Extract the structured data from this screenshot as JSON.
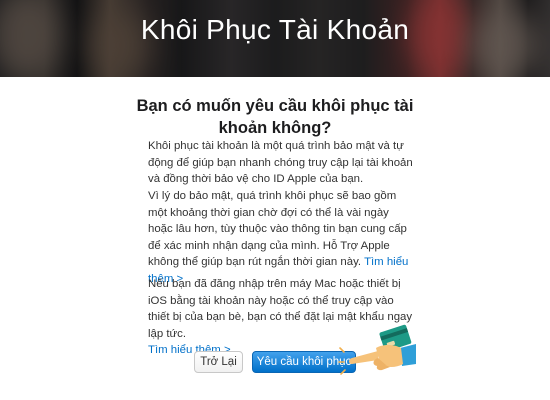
{
  "banner": {
    "title": "Khôi Phục Tài Khoản"
  },
  "main": {
    "heading": "Bạn có muốn yêu cầu khôi phục tài khoản không?",
    "paragraph1": "Khôi phục tài khoản là một quá trình bảo mật và tự động để giúp bạn nhanh chóng truy cập lại tài khoản và đồng thời bảo vệ cho ID Apple của bạn.",
    "paragraph2_text": "Vì lý do bảo mật, quá trình khôi phục sẽ bao gồm một khoảng thời gian chờ đợi có thể là vài ngày hoặc lâu hơn, tùy thuộc vào thông tin bạn cung cấp để xác minh nhận dạng của mình. Hỗ Trợ Apple không thể giúp bạn rút ngắn thời gian này.",
    "paragraph2_link": "Tìm hiểu thêm >",
    "paragraph3_text": "Nếu bạn đã đăng nhập trên máy Mac hoặc thiết bị iOS bằng tài khoản này hoặc có thể truy cập vào thiết bị của bạn bè, bạn có thể đặt lại mật khẩu ngay lập tức.",
    "paragraph3_link": "Tìm hiểu thêm >"
  },
  "buttons": {
    "back_label": "Trở Lại",
    "request_label": "Yêu cầu khôi phục"
  },
  "colors": {
    "link": "#0070c9",
    "primary_button": "#0070c9",
    "banner_title": "#ffffff"
  },
  "icons": {
    "pointer_hand": "pointing-hand-with-card-icon"
  }
}
